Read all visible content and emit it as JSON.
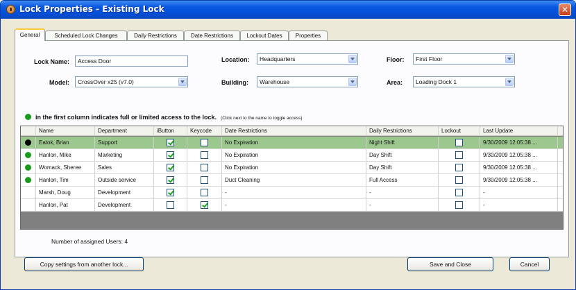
{
  "window": {
    "title": "Lock Properties - Existing Lock"
  },
  "tabs": [
    {
      "label": "General",
      "active": true
    },
    {
      "label": "Scheduled Lock Changes",
      "active": false
    },
    {
      "label": "Daily Restrictions",
      "active": false
    },
    {
      "label": "Date Restrictions",
      "active": false
    },
    {
      "label": "Lockout Dates",
      "active": false
    },
    {
      "label": "Properties",
      "active": false
    }
  ],
  "form": {
    "lock_name": {
      "label": "Lock Name:",
      "value": "Access Door"
    },
    "location": {
      "label": "Location:",
      "value": "Headquarters"
    },
    "floor": {
      "label": "Floor:",
      "value": "First Floor"
    },
    "model": {
      "label": "Model:",
      "value": "CrossOver x25 (v7.0)"
    },
    "building": {
      "label": "Building:",
      "value": "Warehouse"
    },
    "area": {
      "label": "Area:",
      "value": "Loading Dock 1"
    }
  },
  "access_note": {
    "text": "in the first column indicates full or limited access to the lock.",
    "hint": "(Click next to the name to toggle access)",
    "dot_color": "#1a9a1a"
  },
  "grid": {
    "columns": [
      "Name",
      "Department",
      "iButton",
      "Keycode",
      "Date Restrictions",
      "Daily Restrictions",
      "Lockout",
      "Last Update"
    ],
    "rows": [
      {
        "access": "full",
        "name": "Eatok, Brian",
        "department": "Support",
        "ibutton": true,
        "keycode": false,
        "date_restrictions": "No Expiration",
        "daily_restrictions": "Night Shift",
        "lockout": false,
        "last_update": "9/30/2009 12:05:38 ...",
        "selected": true
      },
      {
        "access": "limited",
        "name": "Hanlon, Mike",
        "department": "Marketing",
        "ibutton": true,
        "keycode": false,
        "date_restrictions": "No Expiration",
        "daily_restrictions": "Day Shift",
        "lockout": false,
        "last_update": "9/30/2009 12:05:38 ...",
        "selected": false
      },
      {
        "access": "limited",
        "name": "Womack, Sheree",
        "department": "Sales",
        "ibutton": true,
        "keycode": false,
        "date_restrictions": "No Expiration",
        "daily_restrictions": "Day Shift",
        "lockout": false,
        "last_update": "9/30/2009 12:05:38 ...",
        "selected": false
      },
      {
        "access": "limited",
        "name": "Hanlon, Tim",
        "department": "Outside service",
        "ibutton": true,
        "keycode": false,
        "date_restrictions": "Duct Cleaning",
        "daily_restrictions": "Full Access",
        "lockout": false,
        "last_update": "9/30/2009 12:05:38 ...",
        "selected": false
      },
      {
        "access": "none",
        "name": "Marsh, Doug",
        "department": "Development",
        "ibutton": true,
        "keycode": false,
        "date_restrictions": "-",
        "daily_restrictions": "-",
        "lockout": false,
        "last_update": "-",
        "selected": false
      },
      {
        "access": "none",
        "name": "Hanlon, Pat",
        "department": "Development",
        "ibutton": false,
        "keycode": true,
        "date_restrictions": "-",
        "daily_restrictions": "-",
        "lockout": false,
        "last_update": "-",
        "selected": false
      }
    ],
    "access_colors": {
      "full": "#000000",
      "limited": "#1a9a1a"
    }
  },
  "footer": {
    "user_count": "Number of assigned Users: 4",
    "copy_button": "Copy settings from another lock...",
    "save_button": "Save and Close",
    "cancel_button": "Cancel"
  }
}
